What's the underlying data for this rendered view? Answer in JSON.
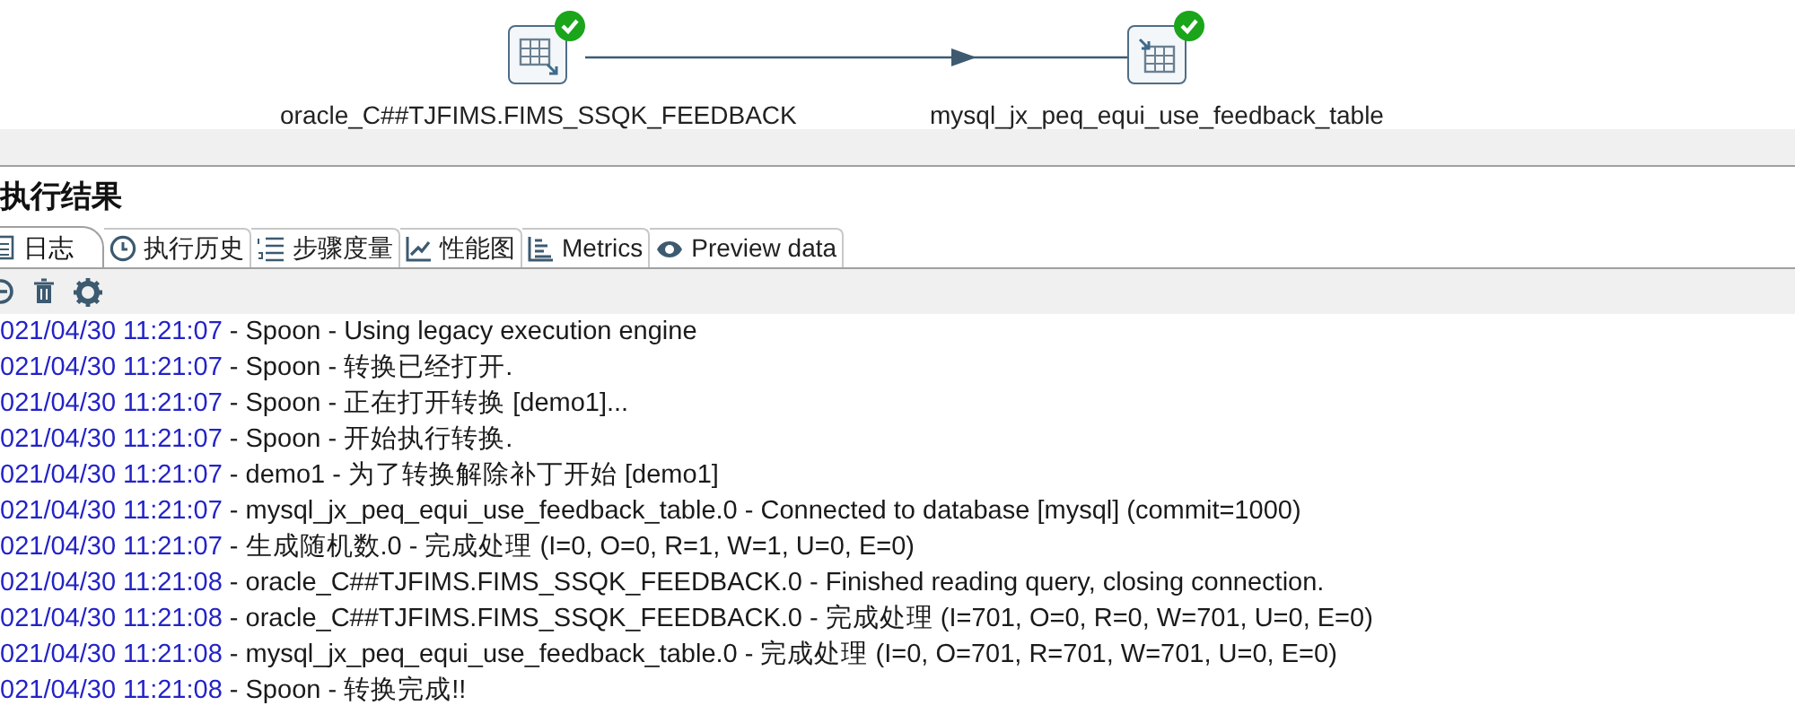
{
  "canvas": {
    "steps": [
      {
        "label": "oracle_C##TJFIMS.FIMS_SSQK_FEEDBACK",
        "kind": "input",
        "done": true
      },
      {
        "label": "mysql_jx_peq_equi_use_feedback_table",
        "kind": "output",
        "done": true
      }
    ]
  },
  "panel": {
    "title": "执行结果",
    "tabs": [
      {
        "label": "日志",
        "kind": "log",
        "selected": true
      },
      {
        "label": "执行历史",
        "kind": "clock",
        "selected": false
      },
      {
        "label": "步骤度量",
        "kind": "steps",
        "selected": false
      },
      {
        "label": "性能图",
        "kind": "chart",
        "selected": false
      },
      {
        "label": "Metrics",
        "kind": "metrics",
        "selected": false
      },
      {
        "label": "Preview data",
        "kind": "eye",
        "selected": false
      }
    ],
    "log": [
      {
        "time": "021/04/30 11:21:07",
        "message": "- Spoon - Using legacy execution engine"
      },
      {
        "time": "021/04/30 11:21:07",
        "message": "- Spoon - 转换已经打开."
      },
      {
        "time": "021/04/30 11:21:07",
        "message": "- Spoon - 正在打开转换 [demo1]..."
      },
      {
        "time": "021/04/30 11:21:07",
        "message": "- Spoon - 开始执行转换."
      },
      {
        "time": "021/04/30 11:21:07",
        "message": "- demo1 - 为了转换解除补丁开始  [demo1]"
      },
      {
        "time": "021/04/30 11:21:07",
        "message": "- mysql_jx_peq_equi_use_feedback_table.0 - Connected to database [mysql] (commit=1000)"
      },
      {
        "time": "021/04/30 11:21:07",
        "message": "- 生成随机数.0 - 完成处理 (I=0, O=0, R=1, W=1, U=0, E=0)"
      },
      {
        "time": "021/04/30 11:21:08",
        "message": "- oracle_C##TJFIMS.FIMS_SSQK_FEEDBACK.0 - Finished reading query, closing connection."
      },
      {
        "time": "021/04/30 11:21:08",
        "message": "- oracle_C##TJFIMS.FIMS_SSQK_FEEDBACK.0 - 完成处理 (I=701, O=0, R=0, W=701, U=0, E=0)"
      },
      {
        "time": "021/04/30 11:21:08",
        "message": "- mysql_jx_peq_equi_use_feedback_table.0 - 完成处理 (I=0, O=701, R=701, W=701, U=0, E=0)"
      },
      {
        "time": "021/04/30 11:21:08",
        "message": "- Spoon - 转换完成!!"
      }
    ]
  }
}
